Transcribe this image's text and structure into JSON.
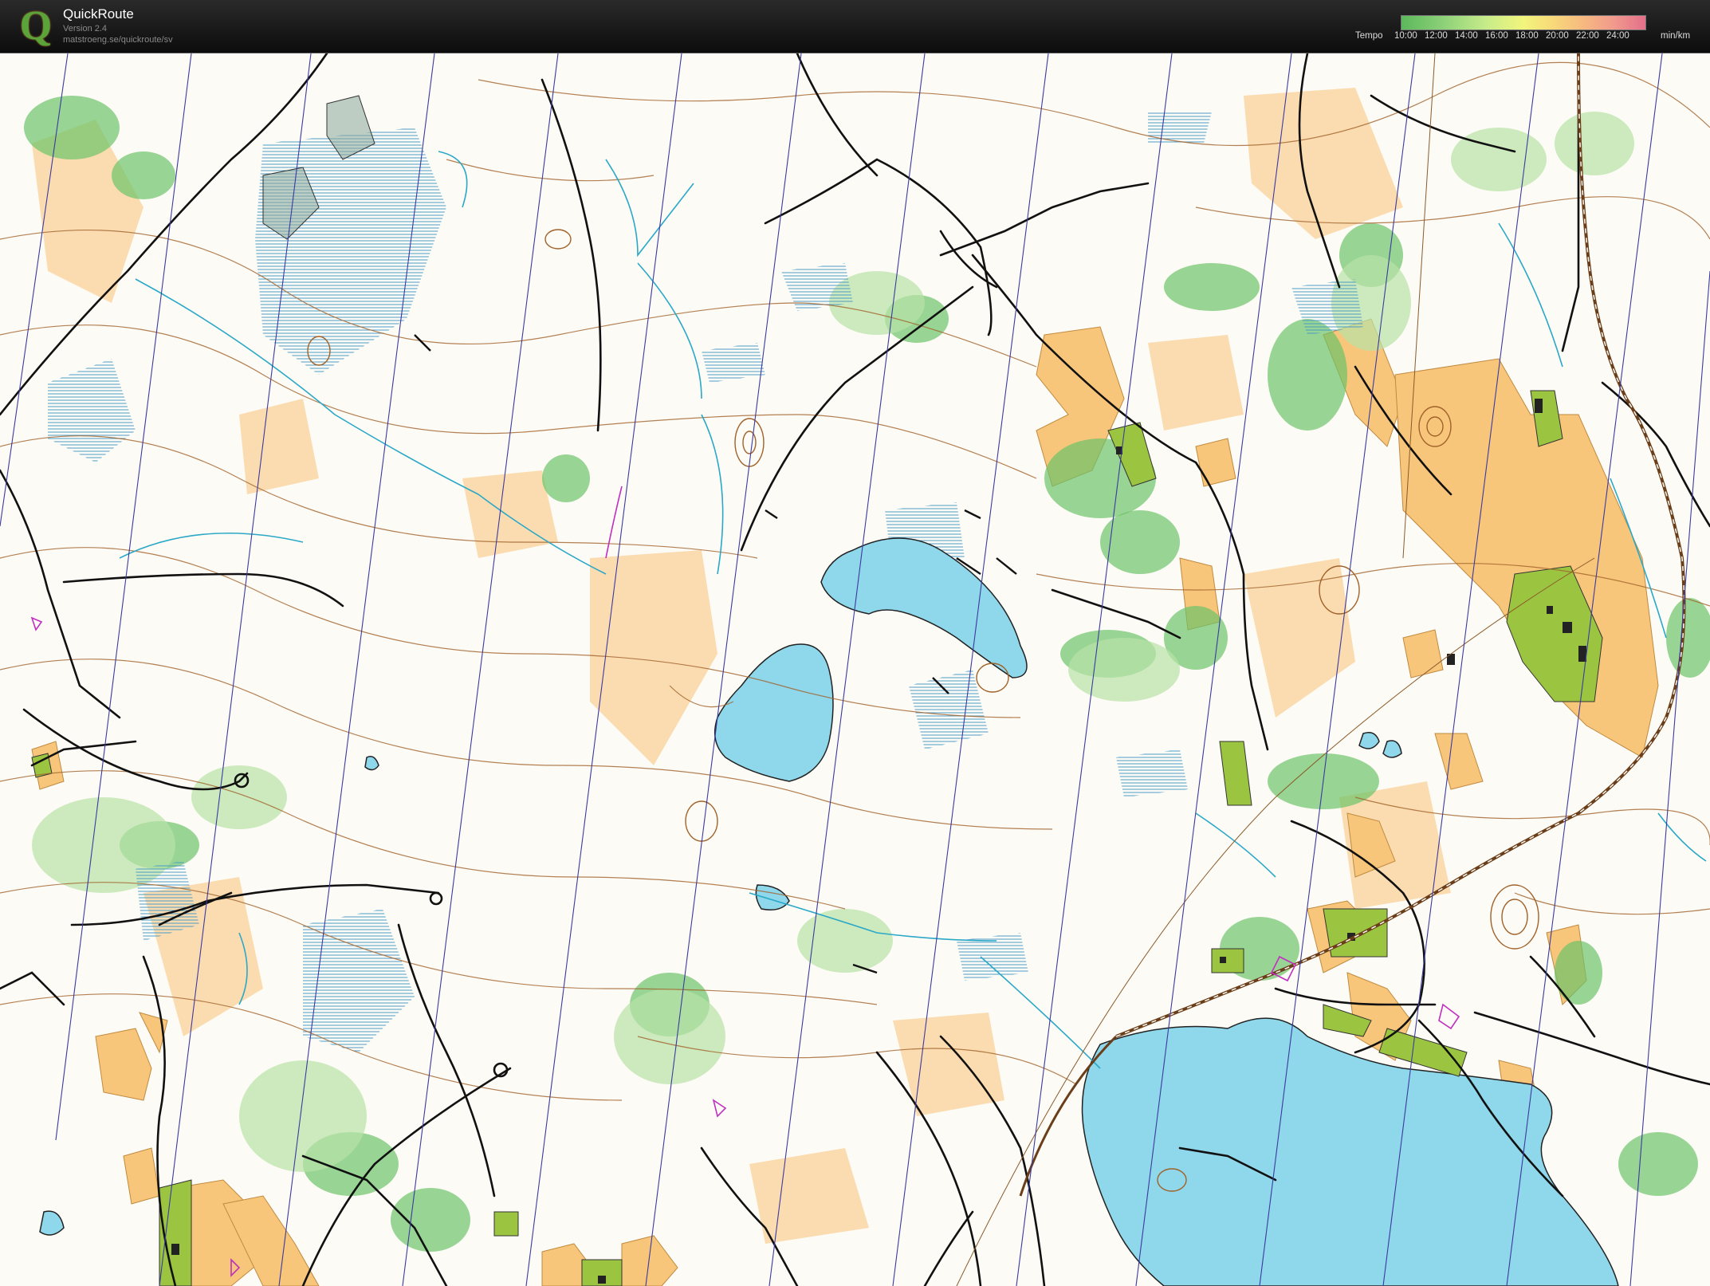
{
  "app": {
    "name": "QuickRoute",
    "version": "Version 2.4",
    "url": "matstroeng.se/quickroute/sv"
  },
  "legend": {
    "title": "Tempo",
    "ticks": [
      "10:00",
      "12:00",
      "14:00",
      "16:00",
      "18:00",
      "20:00",
      "22:00",
      "24:00"
    ],
    "unit": "min/km"
  },
  "colors": {
    "header_bg": "#111111",
    "open_land": "#f8c67a",
    "semi_open": "#fbdcb0",
    "forest_green": "#6cc36a",
    "water": "#8fd7ea",
    "marsh": "#5ea3c6",
    "contour": "#a0622a",
    "path": "#111111",
    "magnetic_north_lines": "#3a3aa0",
    "settlement": "#9bc440"
  },
  "icons": {
    "logo": "quickroute-q-logo"
  }
}
